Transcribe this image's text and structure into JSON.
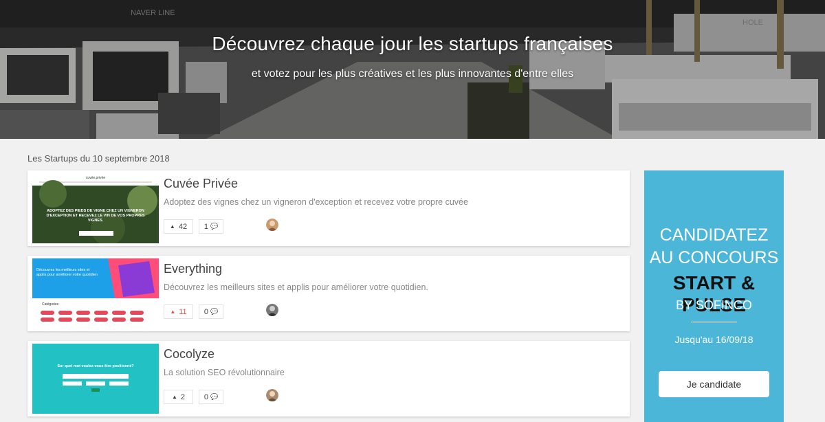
{
  "hero": {
    "title": "Découvrez chaque jour les startups françaises",
    "subtitle": "et votez pour les plus créatives et les plus innovantes d'entre elles",
    "background_sign_1": "NAVER LINE",
    "background_sign_2": "HOLE"
  },
  "date_heading": "Les Startups du 10 septembre 2018",
  "startups": [
    {
      "name": "Cuvée Privée",
      "description": "Adoptez des vignes chez un vigneron d'exception et recevez votre propre cuvée",
      "votes": "42",
      "comments": "1",
      "voted": false,
      "thumb_brand": "cuvée.privée",
      "thumb_text": "ADOPTEZ DES PIEDS DE VIGNE CHEZ UN VIGNERON D'EXCEPTION ET RECEVEZ LE VIN DE VOS PROPRES VIGNES."
    },
    {
      "name": "Everything",
      "description": "Découvrez les meilleurs sites et applis pour améliorer votre quotidien.",
      "votes": "11",
      "comments": "0",
      "voted": true,
      "thumb_text": "Découvrez les meilleurs sites et applis pour améliorer votre quotidien",
      "thumb_section": "Catégories"
    },
    {
      "name": "Cocolyze",
      "description": "La solution SEO révolutionnaire",
      "votes": "2",
      "comments": "0",
      "voted": false,
      "thumb_text": "Sur quel mot voulez-vous être positionné?"
    }
  ],
  "colors": {
    "accent_voted": "#d9534f",
    "ad_background": "#4bb6d8",
    "thumb_everything": "#1ea0e8",
    "thumb_cocolyze": "#22c2c4"
  },
  "ad": {
    "line1": "CANDIDATEZ",
    "line2": "AU CONCOURS",
    "line3": "START & PULSE",
    "line4": "BY SOFINCO",
    "line5": "Jusqu'au 16/09/18",
    "cta": "Je candidate"
  }
}
